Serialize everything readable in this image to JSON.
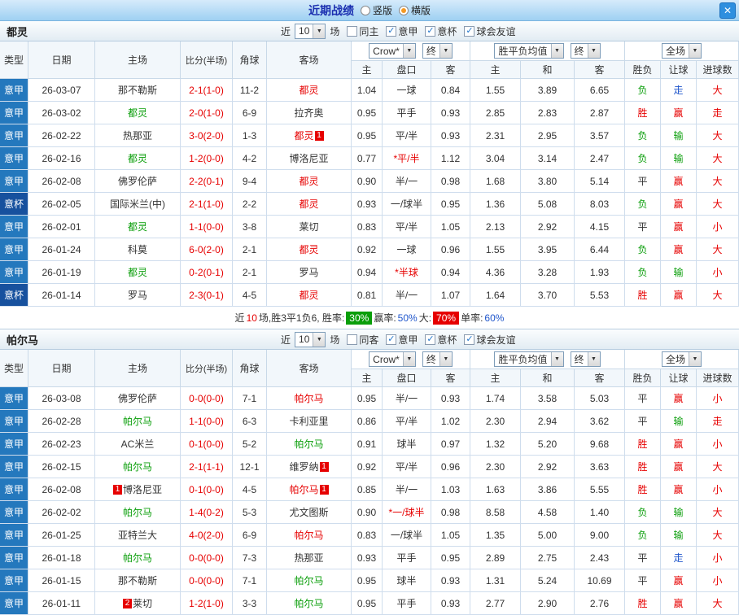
{
  "header": {
    "title": "近期战绩",
    "layout_options": [
      {
        "label": "竖版",
        "selected": false
      },
      {
        "label": "横版",
        "selected": true
      }
    ],
    "close_icon": "✕"
  },
  "colors": {
    "serie_a_bg": "#2478bd",
    "coppa_italia_bg": "#17519e",
    "win_red": "#e60000",
    "lose_green": "#0a9e0a",
    "push_blue": "#2157cc",
    "rate_green_bg": "#0a9e0a",
    "rate_red_bg": "#e60000",
    "titlebar_text": "#1b2fb0"
  },
  "sections": [
    {
      "team": "都灵",
      "filters": {
        "near_label": "近",
        "count": "10",
        "games_label": "场",
        "checkboxes": [
          {
            "label": "同主",
            "checked": false
          },
          {
            "label": "意甲",
            "checked": true
          },
          {
            "label": "意杯",
            "checked": true
          },
          {
            "label": "球会友谊",
            "checked": true
          }
        ]
      },
      "dropdowns": {
        "odds_source": "Crow*",
        "odds_state": "终",
        "avg_label": "胜平负均值",
        "avg_state": "终",
        "scope": "全场"
      },
      "columns": [
        "类型",
        "日期",
        "主场",
        "比分(半场)",
        "角球",
        "客场",
        "主",
        "盘口",
        "客",
        "主",
        "和",
        "客",
        "胜负",
        "让球",
        "进球数"
      ],
      "rows": [
        {
          "league": "意甲",
          "date": "26-03-07",
          "home": {
            "name": "那不勒斯",
            "color": "black"
          },
          "score": "2-1(1-0)",
          "corners": "11-2",
          "away": {
            "name": "都灵",
            "color": "red"
          },
          "odds": [
            "1.04",
            "一球",
            "0.84"
          ],
          "avg": [
            "1.55",
            "3.89",
            "6.65"
          ],
          "result": {
            "text": "负",
            "color": "green"
          },
          "let": {
            "text": "走",
            "color": "blue"
          },
          "goals": {
            "text": "大",
            "color": "red"
          }
        },
        {
          "league": "意甲",
          "date": "26-03-02",
          "home": {
            "name": "都灵",
            "color": "green"
          },
          "score": "2-0(1-0)",
          "corners": "6-9",
          "away": {
            "name": "拉齐奥",
            "color": "black"
          },
          "odds": [
            "0.95",
            "平手",
            "0.93"
          ],
          "avg": [
            "2.85",
            "2.83",
            "2.87"
          ],
          "result": {
            "text": "胜",
            "color": "red"
          },
          "let": {
            "text": "赢",
            "color": "red"
          },
          "goals": {
            "text": "走",
            "color": "red"
          }
        },
        {
          "league": "意甲",
          "date": "26-02-22",
          "home": {
            "name": "热那亚",
            "color": "black"
          },
          "score": "3-0(2-0)",
          "corners": "1-3",
          "away": {
            "name": "都灵",
            "color": "red",
            "badge_after": "1"
          },
          "odds": [
            "0.95",
            "平/半",
            "0.93"
          ],
          "avg": [
            "2.31",
            "2.95",
            "3.57"
          ],
          "result": {
            "text": "负",
            "color": "green"
          },
          "let": {
            "text": "输",
            "color": "green"
          },
          "goals": {
            "text": "大",
            "color": "red"
          }
        },
        {
          "league": "意甲",
          "date": "26-02-16",
          "home": {
            "name": "都灵",
            "color": "green"
          },
          "score": "1-2(0-0)",
          "corners": "4-2",
          "away": {
            "name": "博洛尼亚",
            "color": "black"
          },
          "odds": [
            "0.77",
            "*平/半",
            "1.12"
          ],
          "avg": [
            "3.04",
            "3.14",
            "2.47"
          ],
          "result": {
            "text": "负",
            "color": "green"
          },
          "let": {
            "text": "输",
            "color": "green"
          },
          "goals": {
            "text": "大",
            "color": "red"
          }
        },
        {
          "league": "意甲",
          "date": "26-02-08",
          "home": {
            "name": "佛罗伦萨",
            "color": "black"
          },
          "score": "2-2(0-1)",
          "corners": "9-4",
          "away": {
            "name": "都灵",
            "color": "red"
          },
          "odds": [
            "0.90",
            "半/一",
            "0.98"
          ],
          "avg": [
            "1.68",
            "3.80",
            "5.14"
          ],
          "result": {
            "text": "平",
            "color": "black"
          },
          "let": {
            "text": "赢",
            "color": "red"
          },
          "goals": {
            "text": "大",
            "color": "red"
          }
        },
        {
          "league": "意杯",
          "date": "26-02-05",
          "home": {
            "name": "国际米兰(中)",
            "color": "black"
          },
          "score": "2-1(1-0)",
          "corners": "2-2",
          "away": {
            "name": "都灵",
            "color": "red"
          },
          "odds": [
            "0.93",
            "一/球半",
            "0.95"
          ],
          "avg": [
            "1.36",
            "5.08",
            "8.03"
          ],
          "result": {
            "text": "负",
            "color": "green"
          },
          "let": {
            "text": "赢",
            "color": "red"
          },
          "goals": {
            "text": "大",
            "color": "red"
          }
        },
        {
          "league": "意甲",
          "date": "26-02-01",
          "home": {
            "name": "都灵",
            "color": "green"
          },
          "score": "1-1(0-0)",
          "corners": "3-8",
          "away": {
            "name": "莱切",
            "color": "black"
          },
          "odds": [
            "0.83",
            "平/半",
            "1.05"
          ],
          "avg": [
            "2.13",
            "2.92",
            "4.15"
          ],
          "result": {
            "text": "平",
            "color": "black"
          },
          "let": {
            "text": "赢",
            "color": "red"
          },
          "goals": {
            "text": "小",
            "color": "red"
          }
        },
        {
          "league": "意甲",
          "date": "26-01-24",
          "home": {
            "name": "科莫",
            "color": "black"
          },
          "score": "6-0(2-0)",
          "corners": "2-1",
          "away": {
            "name": "都灵",
            "color": "red"
          },
          "odds": [
            "0.92",
            "一球",
            "0.96"
          ],
          "avg": [
            "1.55",
            "3.95",
            "6.44"
          ],
          "result": {
            "text": "负",
            "color": "green"
          },
          "let": {
            "text": "赢",
            "color": "red"
          },
          "goals": {
            "text": "大",
            "color": "red"
          }
        },
        {
          "league": "意甲",
          "date": "26-01-19",
          "home": {
            "name": "都灵",
            "color": "green"
          },
          "score": "0-2(0-1)",
          "corners": "2-1",
          "away": {
            "name": "罗马",
            "color": "black"
          },
          "odds": [
            "0.94",
            "*半球",
            "0.94"
          ],
          "avg": [
            "4.36",
            "3.28",
            "1.93"
          ],
          "result": {
            "text": "负",
            "color": "green"
          },
          "let": {
            "text": "输",
            "color": "green"
          },
          "goals": {
            "text": "小",
            "color": "red"
          }
        },
        {
          "league": "意杯",
          "date": "26-01-14",
          "home": {
            "name": "罗马",
            "color": "black"
          },
          "score": "2-3(0-1)",
          "corners": "4-5",
          "away": {
            "name": "都灵",
            "color": "red"
          },
          "odds": [
            "0.81",
            "半/一",
            "1.07"
          ],
          "avg": [
            "1.64",
            "3.70",
            "5.53"
          ],
          "result": {
            "text": "胜",
            "color": "red"
          },
          "let": {
            "text": "赢",
            "color": "red"
          },
          "goals": {
            "text": "大",
            "color": "red"
          }
        }
      ],
      "summary": [
        {
          "text": "近",
          "style": "plain"
        },
        {
          "text": "10",
          "style": "red"
        },
        {
          "text": "场,胜3平1负6, 胜率: ",
          "style": "plain"
        },
        {
          "text": "30%",
          "style": "badge-green"
        },
        {
          "text": " 赢率:",
          "style": "plain"
        },
        {
          "text": "50%",
          "style": "blue"
        },
        {
          "text": " 大: ",
          "style": "plain"
        },
        {
          "text": "70%",
          "style": "badge-red"
        },
        {
          "text": " 单率:",
          "style": "plain"
        },
        {
          "text": "60%",
          "style": "blue"
        }
      ]
    },
    {
      "team": "帕尔马",
      "filters": {
        "near_label": "近",
        "count": "10",
        "games_label": "场",
        "checkboxes": [
          {
            "label": "同客",
            "checked": false
          },
          {
            "label": "意甲",
            "checked": true
          },
          {
            "label": "意杯",
            "checked": true
          },
          {
            "label": "球会友谊",
            "checked": true
          }
        ]
      },
      "dropdowns": {
        "odds_source": "Crow*",
        "odds_state": "终",
        "avg_label": "胜平负均值",
        "avg_state": "终",
        "scope": "全场"
      },
      "columns": [
        "类型",
        "日期",
        "主场",
        "比分(半场)",
        "角球",
        "客场",
        "主",
        "盘口",
        "客",
        "主",
        "和",
        "客",
        "胜负",
        "让球",
        "进球数"
      ],
      "rows": [
        {
          "league": "意甲",
          "date": "26-03-08",
          "home": {
            "name": "佛罗伦萨",
            "color": "black"
          },
          "score": "0-0(0-0)",
          "corners": "7-1",
          "away": {
            "name": "帕尔马",
            "color": "red"
          },
          "odds": [
            "0.95",
            "半/一",
            "0.93"
          ],
          "avg": [
            "1.74",
            "3.58",
            "5.03"
          ],
          "result": {
            "text": "平",
            "color": "black"
          },
          "let": {
            "text": "赢",
            "color": "red"
          },
          "goals": {
            "text": "小",
            "color": "red"
          }
        },
        {
          "league": "意甲",
          "date": "26-02-28",
          "home": {
            "name": "帕尔马",
            "color": "green"
          },
          "score": "1-1(0-0)",
          "corners": "6-3",
          "away": {
            "name": "卡利亚里",
            "color": "black"
          },
          "odds": [
            "0.86",
            "平/半",
            "1.02"
          ],
          "avg": [
            "2.30",
            "2.94",
            "3.62"
          ],
          "result": {
            "text": "平",
            "color": "black"
          },
          "let": {
            "text": "输",
            "color": "green"
          },
          "goals": {
            "text": "走",
            "color": "red"
          }
        },
        {
          "league": "意甲",
          "date": "26-02-23",
          "home": {
            "name": "AC米兰",
            "color": "black"
          },
          "score": "0-1(0-0)",
          "corners": "5-2",
          "away": {
            "name": "帕尔马",
            "color": "green"
          },
          "odds": [
            "0.91",
            "球半",
            "0.97"
          ],
          "avg": [
            "1.32",
            "5.20",
            "9.68"
          ],
          "result": {
            "text": "胜",
            "color": "red"
          },
          "let": {
            "text": "赢",
            "color": "red"
          },
          "goals": {
            "text": "小",
            "color": "red"
          }
        },
        {
          "league": "意甲",
          "date": "26-02-15",
          "home": {
            "name": "帕尔马",
            "color": "green"
          },
          "score": "2-1(1-1)",
          "corners": "12-1",
          "away": {
            "name": "维罗纳",
            "color": "black",
            "badge_after": "1"
          },
          "odds": [
            "0.92",
            "平/半",
            "0.96"
          ],
          "avg": [
            "2.30",
            "2.92",
            "3.63"
          ],
          "result": {
            "text": "胜",
            "color": "red"
          },
          "let": {
            "text": "赢",
            "color": "red"
          },
          "goals": {
            "text": "大",
            "color": "red"
          }
        },
        {
          "league": "意甲",
          "date": "26-02-08",
          "home": {
            "name": "博洛尼亚",
            "color": "black",
            "badge_before": "1"
          },
          "score": "0-1(0-0)",
          "corners": "4-5",
          "away": {
            "name": "帕尔马",
            "color": "red",
            "badge_after": "1"
          },
          "odds": [
            "0.85",
            "半/一",
            "1.03"
          ],
          "avg": [
            "1.63",
            "3.86",
            "5.55"
          ],
          "result": {
            "text": "胜",
            "color": "red"
          },
          "let": {
            "text": "赢",
            "color": "red"
          },
          "goals": {
            "text": "小",
            "color": "red"
          }
        },
        {
          "league": "意甲",
          "date": "26-02-02",
          "home": {
            "name": "帕尔马",
            "color": "green"
          },
          "score": "1-4(0-2)",
          "corners": "5-3",
          "away": {
            "name": "尤文图斯",
            "color": "black"
          },
          "odds": [
            "0.90",
            "*一/球半",
            "0.98"
          ],
          "avg": [
            "8.58",
            "4.58",
            "1.40"
          ],
          "result": {
            "text": "负",
            "color": "green"
          },
          "let": {
            "text": "输",
            "color": "green"
          },
          "goals": {
            "text": "大",
            "color": "red"
          }
        },
        {
          "league": "意甲",
          "date": "26-01-25",
          "home": {
            "name": "亚特兰大",
            "color": "black"
          },
          "score": "4-0(2-0)",
          "corners": "6-9",
          "away": {
            "name": "帕尔马",
            "color": "red"
          },
          "odds": [
            "0.83",
            "一/球半",
            "1.05"
          ],
          "avg": [
            "1.35",
            "5.00",
            "9.00"
          ],
          "result": {
            "text": "负",
            "color": "green"
          },
          "let": {
            "text": "输",
            "color": "green"
          },
          "goals": {
            "text": "大",
            "color": "red"
          }
        },
        {
          "league": "意甲",
          "date": "26-01-18",
          "home": {
            "name": "帕尔马",
            "color": "green"
          },
          "score": "0-0(0-0)",
          "corners": "7-3",
          "away": {
            "name": "热那亚",
            "color": "black"
          },
          "odds": [
            "0.93",
            "平手",
            "0.95"
          ],
          "avg": [
            "2.89",
            "2.75",
            "2.43"
          ],
          "result": {
            "text": "平",
            "color": "black"
          },
          "let": {
            "text": "走",
            "color": "blue"
          },
          "goals": {
            "text": "小",
            "color": "red"
          }
        },
        {
          "league": "意甲",
          "date": "26-01-15",
          "home": {
            "name": "那不勒斯",
            "color": "black"
          },
          "score": "0-0(0-0)",
          "corners": "7-1",
          "away": {
            "name": "帕尔马",
            "color": "green"
          },
          "odds": [
            "0.95",
            "球半",
            "0.93"
          ],
          "avg": [
            "1.31",
            "5.24",
            "10.69"
          ],
          "result": {
            "text": "平",
            "color": "black"
          },
          "let": {
            "text": "赢",
            "color": "red"
          },
          "goals": {
            "text": "小",
            "color": "red"
          }
        },
        {
          "league": "意甲",
          "date": "26-01-11",
          "home": {
            "name": "莱切",
            "color": "black",
            "badge_before": "2"
          },
          "score": "1-2(1-0)",
          "corners": "3-3",
          "away": {
            "name": "帕尔马",
            "color": "green"
          },
          "odds": [
            "0.95",
            "平手",
            "0.93"
          ],
          "avg": [
            "2.77",
            "2.90",
            "2.76"
          ],
          "result": {
            "text": "胜",
            "color": "red"
          },
          "let": {
            "text": "赢",
            "color": "red"
          },
          "goals": {
            "text": "大",
            "color": "red"
          }
        }
      ]
    }
  ]
}
